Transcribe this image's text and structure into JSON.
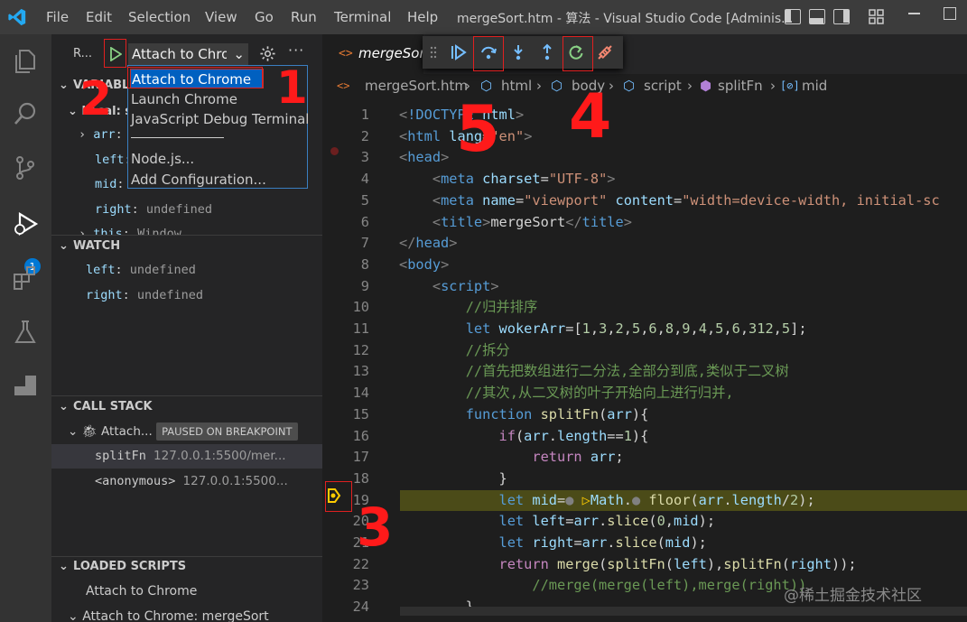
{
  "menu": [
    "File",
    "Edit",
    "Selection",
    "View",
    "Go",
    "Run",
    "Terminal",
    "Help"
  ],
  "window_title": "mergeSort.htm - 算法 - Visual Studio Code [Adminis...",
  "activity": {
    "debug_badge": "1"
  },
  "run": {
    "label": "R...",
    "config_selected": "Attach to Chrome",
    "dropdown": [
      "Attach to Chrome",
      "Launch Chrome",
      "JavaScript Debug Terminal",
      "Node.js...",
      "Add Configuration..."
    ]
  },
  "variables": {
    "header": "VARIABL",
    "local_label": "Local: s",
    "rows": [
      {
        "name": "arr",
        "value": ""
      },
      {
        "name": "left",
        "value": ""
      },
      {
        "name": "mid",
        "value": "undefined"
      },
      {
        "name": "right",
        "value": "undefined"
      },
      {
        "name": "this",
        "value": "Window"
      }
    ]
  },
  "watch": {
    "header": "WATCH",
    "items": [
      {
        "name": "left",
        "value": "undefined"
      },
      {
        "name": "right",
        "value": "undefined"
      }
    ]
  },
  "callstack": {
    "header": "CALL STACK",
    "thread": "Attach...",
    "badge": "PAUSED ON BREAKPOINT",
    "frames": [
      {
        "name": "splitFn",
        "location": "127.0.0.1:5500/mer..."
      },
      {
        "name": "<anonymous>",
        "location": "127.0.0.1:5500..."
      }
    ]
  },
  "loaded_scripts": {
    "header": "LOADED SCRIPTS",
    "items": [
      "Attach to Chrome",
      "Attach to Chrome: mergeSort"
    ]
  },
  "editor": {
    "tab": "mergeSort",
    "breadcrumb": [
      "mergeSort.htm",
      "html",
      "body",
      "script",
      "splitFn",
      "mid"
    ],
    "lines": [
      {
        "n": "1",
        "html": "<span class='t-gray'>&lt;</span><span class='t-tag'>!DOCTYPE</span> <span class='t-attr'>html</span><span class='t-gray'>&gt;</span>"
      },
      {
        "n": "2",
        "html": "<span class='t-gray'>&lt;</span><span class='t-tag'>html</span> <span class='t-attr'>lang</span>=<span class='t-str'>\"en\"</span><span class='t-gray'>&gt;</span>"
      },
      {
        "n": "3",
        "html": "<span class='t-gray'>&lt;</span><span class='t-tag'>head</span><span class='t-gray'>&gt;</span>"
      },
      {
        "n": "4",
        "html": "    <span class='t-gray'>&lt;</span><span class='t-tag'>meta</span> <span class='t-attr'>charset</span>=<span class='t-str'>\"UTF-8\"</span><span class='t-gray'>&gt;</span>"
      },
      {
        "n": "5",
        "html": "    <span class='t-gray'>&lt;</span><span class='t-tag'>meta</span> <span class='t-attr'>name</span>=<span class='t-str'>\"viewport\"</span> <span class='t-attr'>content</span>=<span class='t-str'>\"width=device-width, initial-sc</span>"
      },
      {
        "n": "6",
        "html": "    <span class='t-gray'>&lt;</span><span class='t-tag'>title</span><span class='t-gray'>&gt;</span>mergeSort<span class='t-gray'>&lt;/</span><span class='t-tag'>title</span><span class='t-gray'>&gt;</span>"
      },
      {
        "n": "7",
        "html": "<span class='t-gray'>&lt;/</span><span class='t-tag'>head</span><span class='t-gray'>&gt;</span>"
      },
      {
        "n": "8",
        "html": "<span class='t-gray'>&lt;</span><span class='t-tag'>body</span><span class='t-gray'>&gt;</span>"
      },
      {
        "n": "9",
        "html": "    <span class='t-gray'>&lt;</span><span class='t-tag'>script</span><span class='t-gray'>&gt;</span>"
      },
      {
        "n": "10",
        "html": "        <span class='t-cm'>//归并排序</span>"
      },
      {
        "n": "11",
        "html": "        <span class='t-kw'>let</span> <span class='t-var'>wokerArr</span>=[<span class='t-num'>1</span>,<span class='t-num'>3</span>,<span class='t-num'>2</span>,<span class='t-num'>5</span>,<span class='t-num'>6</span>,<span class='t-num'>8</span>,<span class='t-num'>9</span>,<span class='t-num'>4</span>,<span class='t-num'>5</span>,<span class='t-num'>6</span>,<span class='t-num'>312</span>,<span class='t-num'>5</span>];"
      },
      {
        "n": "12",
        "html": "        <span class='t-cm'>//拆分</span>"
      },
      {
        "n": "13",
        "html": "        <span class='t-cm'>//首先把数组进行二分法,全部分到底,类似于二叉树</span>"
      },
      {
        "n": "14",
        "html": "        <span class='t-cm'>//其次,从二叉树的叶子开始向上进行归并,</span>"
      },
      {
        "n": "15",
        "html": "        <span class='t-kw'>function</span> <span class='t-fn'>splitFn</span>(<span class='t-var'>arr</span>){"
      },
      {
        "n": "16",
        "html": "            <span class='t-ctrl'>if</span>(<span class='t-var'>arr</span>.<span class='t-var'>length</span>==<span class='t-num'>1</span>){"
      },
      {
        "n": "17",
        "html": "                <span class='t-ctrl'>return</span> <span class='t-var'>arr</span>;"
      },
      {
        "n": "18",
        "html": "            }"
      },
      {
        "n": "19",
        "html": "            <span class='t-kw'>let</span> <span class='t-var'>mid</span>=<span class='t-gray'>●</span> <span style='color:#ffcc00'>▷</span><span class='t-var'>Math</span>.<span class='t-gray'>●</span> <span class='t-fn'>floor</span>(<span class='t-var'>arr</span>.<span class='t-var'>length</span>/<span class='t-num'>2</span>);"
      },
      {
        "n": "20",
        "html": "            <span class='t-kw'>let</span> <span class='t-var'>left</span>=<span class='t-var'>arr</span>.<span class='t-fn'>slice</span>(<span class='t-num'>0</span>,<span class='t-var'>mid</span>);"
      },
      {
        "n": "21",
        "html": "            <span class='t-kw'>let</span> <span class='t-var'>right</span>=<span class='t-var'>arr</span>.<span class='t-fn'>slice</span>(<span class='t-var'>mid</span>);"
      },
      {
        "n": "22",
        "html": "            <span class='t-ctrl'>return</span> <span class='t-fn'>merge</span>(<span class='t-fn'>splitFn</span>(<span class='t-var'>left</span>),<span class='t-fn'>splitFn</span>(<span class='t-var'>right</span>));"
      },
      {
        "n": "23",
        "html": "                <span class='t-cm'>//merge(merge(left),merge(right))</span>"
      },
      {
        "n": "24",
        "html": "        }"
      }
    ]
  },
  "annotations": [
    "1",
    "2",
    "3",
    "4",
    "5"
  ],
  "watermark": "@稀土掘金技术社区",
  "colors": {
    "accent": "#0078d4",
    "highlight_line": "#4b4b18",
    "annotation": "#ff1a1a"
  }
}
